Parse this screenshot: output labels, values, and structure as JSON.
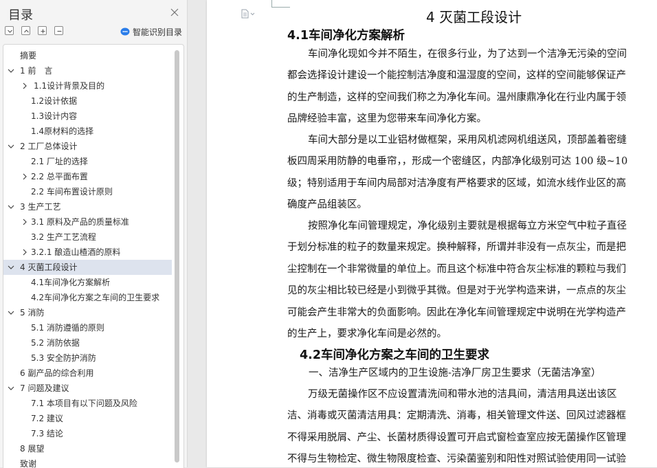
{
  "toc": {
    "title": "目录",
    "smart_label": "智能识别目录",
    "items": [
      {
        "label": "摘要",
        "expand": ""
      },
      {
        "label": "1 前　言",
        "expand": "open"
      },
      {
        "label": "1.1设计背景及目的",
        "expand": "closed"
      },
      {
        "label": "1.2设计依据",
        "expand": ""
      },
      {
        "label": "1.3设计内容",
        "expand": ""
      },
      {
        "label": "1.4原材料的选择",
        "expand": ""
      },
      {
        "label": "2  工厂总体设计",
        "expand": "open"
      },
      {
        "label": "2.1  厂址的选择",
        "expand": ""
      },
      {
        "label": "2.2  总平面布置",
        "expand": "closed"
      },
      {
        "label": "2.2  车间布置设计原则",
        "expand": ""
      },
      {
        "label": "3  生产工艺",
        "expand": "open"
      },
      {
        "label": "3.1  原料及产品的质量标准",
        "expand": "closed"
      },
      {
        "label": "3.2  生产工艺流程",
        "expand": ""
      },
      {
        "label": "3.2.1  酿造山楂酒的原料",
        "expand": "closed"
      },
      {
        "label": "4  灭菌工段设计",
        "expand": "open"
      },
      {
        "label": "4.1车间净化方案解析",
        "expand": ""
      },
      {
        "label": "4.2车间净化方案之车间的卫生要求",
        "expand": ""
      },
      {
        "label": "5  消防",
        "expand": "open"
      },
      {
        "label": "5.1  消防遵循的原则",
        "expand": ""
      },
      {
        "label": "5.2  消防依据",
        "expand": ""
      },
      {
        "label": "5.3  安全防护消防",
        "expand": ""
      },
      {
        "label": "6  副产品的综合利用",
        "expand": ""
      },
      {
        "label": "7  问题及建议",
        "expand": "open"
      },
      {
        "label": "7.1  本项目有以下问题及风险",
        "expand": ""
      },
      {
        "label": "7.2  建议",
        "expand": ""
      },
      {
        "label": "7.3  结论",
        "expand": ""
      },
      {
        "label": "8  展望",
        "expand": ""
      },
      {
        "label": "致谢",
        "expand": ""
      }
    ]
  },
  "document": {
    "chapter_title": "4  灭菌工段设计",
    "section1_title": "4.1车间净化方案解析",
    "p1": [
      "车间净化现如今并不陌生，在很多行业，为了达到一个洁净无污染的空间",
      "都会选择设计建设一个能控制洁净度和温湿度的空间，这样的空间能够保证产",
      "的生产制造，这样的空间我们称之为净化车间。温州康鼎净化在行业内属于领",
      "品牌经验丰富，这里为您带来车间净化方案。"
    ],
    "p2": [
      "车间大部分是以工业铝材做框架，采用风机滤网机组送风，顶部盖着密缝",
      "板四周采用防静的电垂帘，，形成一个密缝区，内部净化级别可达 100 级~10",
      "级；特别适用于车间内局部对洁净度有严格要求的区域，如流水线作业区的高",
      "确度产品组装区。"
    ],
    "p3": [
      "按照净化车间管理规定，净化级别主要就是根据每立方米空气中粒子直径",
      "于划分标准的粒子的数量来规定。换种解释，所谓并非没有一点灰尘，而是把",
      "尘控制在一个非常微量的单位上。而且这个标准中符合灰尘标准的颗粒与我们",
      "见的灰尘相比较已经是小到微乎其微。但是对于光学构造来讲，一点点的灰尘",
      "可能会产生非常大的负面影响。因此在净化车间管理规定中说明在光学构造产",
      "的生产上，要求净化车间是必然的。"
    ],
    "section2_title": "4.2车间净化方案之车间的卫生要求",
    "sub1": "一、洁净生产区域内的卫生设施-洁净厂房卫生要求（无菌洁净室）",
    "p4": [
      "万级无菌操作区不应设置清洗间和带水池的洁具间，清洁用具送出该区",
      "洁、消毒或灭菌清洁用具：定期清洗、消毒，相关管理文件送、回风过滤器框",
      "不得采用脱屑、产尘、长菌材质得设置可开启式窗检查室应按无菌操作区管理",
      "不得与生物检定、微生物限度检查、污染菌鉴别和阳性对照试验使用同一试验"
    ]
  },
  "colors": {
    "selected_row": "#dde3ee",
    "accent": "#2b7de9"
  }
}
